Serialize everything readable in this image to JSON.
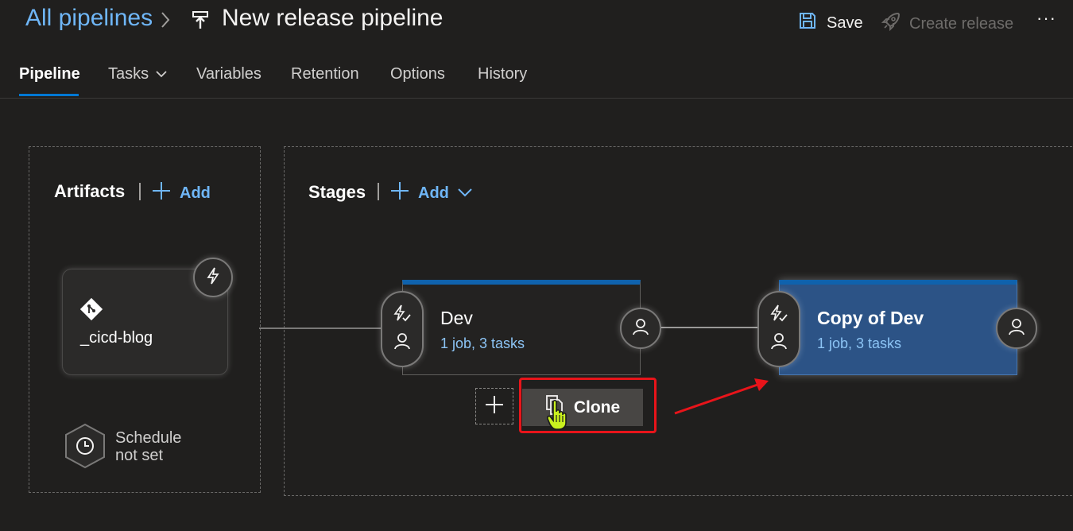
{
  "header": {
    "breadcrumb": "All pipelines",
    "title": "New release pipeline",
    "save_label": "Save",
    "create_release_label": "Create release",
    "more_label": "···"
  },
  "tabs": [
    {
      "label": "Pipeline"
    },
    {
      "label": "Tasks"
    },
    {
      "label": "Variables"
    },
    {
      "label": "Retention"
    },
    {
      "label": "Options"
    },
    {
      "label": "History"
    }
  ],
  "artifacts": {
    "title": "Artifacts",
    "add_label": "Add",
    "items": [
      {
        "name": "_cicd-blog"
      }
    ],
    "schedule_label_line1": "Schedule",
    "schedule_label_line2": "not set"
  },
  "stages": {
    "title": "Stages",
    "add_label": "Add",
    "items": [
      {
        "name": "Dev",
        "summary": "1 job, 3 tasks"
      },
      {
        "name": "Copy of Dev",
        "summary": "1 job, 3 tasks"
      }
    ],
    "clone_label": "Clone"
  },
  "colors": {
    "accent": "#0078d4",
    "link": "#6fb6f7",
    "selected_stage": "#2c5386",
    "highlight": "#e8141a"
  }
}
